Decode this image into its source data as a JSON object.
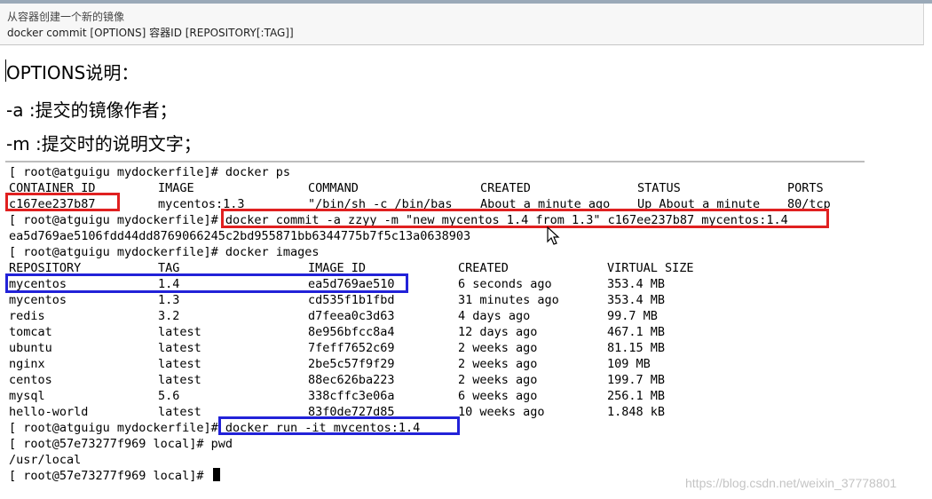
{
  "notes": {
    "line1": "从容器创建一个新的镜像",
    "line2": "docker commit [OPTIONS] 容器ID [REPOSITORY[:TAG]]"
  },
  "doc": {
    "options_heading": "OPTIONS说明：",
    "option_a": "-a :提交的镜像作者；",
    "option_m": "-m :提交时的说明文字；"
  },
  "terminal": {
    "ps_cmd": "[ root@atguigu mydockerfile]# docker ps",
    "ps_headers": [
      "CONTAINER ID",
      "IMAGE",
      "COMMAND",
      "CREATED",
      "STATUS",
      "PORTS"
    ],
    "ps_row": [
      "c167ee237b87",
      "mycentos:1.3",
      "\"/bin/sh -c /bin/bas",
      "About a minute ago",
      "Up About a minute",
      "80/tcp"
    ],
    "commit_cmd": "[ root@atguigu mydockerfile]# docker commit -a zzyy -m \"new mycentos 1.4 from 1.3\" c167ee237b87 mycentos:1.4",
    "commit_hash": "ea5d769ae5106fdd44dd8769066245c2bd955871bb6344775b7f5c13a0638903",
    "images_cmd": "[ root@atguigu mydockerfile]# docker images",
    "images_headers": [
      "REPOSITORY",
      "TAG",
      "IMAGE ID",
      "CREATED",
      "VIRTUAL SIZE"
    ],
    "images_rows": [
      [
        "mycentos",
        "1.4",
        "ea5d769ae510",
        "6 seconds ago",
        "353.4 MB"
      ],
      [
        "mycentos",
        "1.3",
        "cd535f1b1fbd",
        "31 minutes ago",
        "353.4 MB"
      ],
      [
        "redis",
        "3.2",
        "d7feea0c3d63",
        "4 days ago",
        "99.7 MB"
      ],
      [
        "tomcat",
        "latest",
        "8e956bfcc8a4",
        "12 days ago",
        "467.1 MB"
      ],
      [
        "ubuntu",
        "latest",
        "7feff7652c69",
        "2 weeks ago",
        "81.15 MB"
      ],
      [
        "nginx",
        "latest",
        "2be5c57f9f29",
        "2 weeks ago",
        "109 MB"
      ],
      [
        "centos",
        "latest",
        "88ec626ba223",
        "2 weeks ago",
        "199.7 MB"
      ],
      [
        "mysql",
        "5.6",
        "338cffc3e06a",
        "6 weeks ago",
        "256.1 MB"
      ],
      [
        "hello-world",
        "latest",
        "83f0de727d85",
        "10 weeks ago",
        "1.848 kB"
      ]
    ],
    "run_cmd": "[ root@atguigu mydockerfile]# docker run -it mycentos:1.4",
    "pwd_cmd": "[ root@57e73277f969 local]# pwd",
    "pwd_output": "/usr/local",
    "final_prompt": "[ root@57e73277f969 local]# "
  },
  "watermark": "https://blog.csdn.net/weixin_37778801",
  "colors": {
    "red_highlight": "#e02020",
    "blue_highlight": "#2222d8"
  }
}
